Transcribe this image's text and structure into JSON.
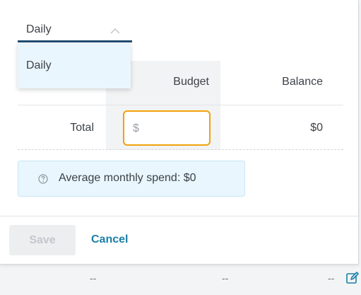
{
  "period_select": {
    "value": "Daily",
    "options": [
      "Daily"
    ],
    "accent_color": "#234d73"
  },
  "table": {
    "headers": {
      "budget": "Budget",
      "balance": "Balance"
    },
    "rows": [
      {
        "label": "Total",
        "budget_placeholder": "$",
        "budget_value": "",
        "balance": "$0"
      }
    ]
  },
  "info": {
    "icon": "question-circle-icon",
    "text": "Average monthly spend: $0"
  },
  "footer": {
    "save_label": "Save",
    "cancel_label": "Cancel",
    "cancel_color": "#1a7fa6"
  },
  "underlying_row": {
    "cells": [
      "--",
      "--",
      "--"
    ],
    "edit_icon": "edit-icon"
  },
  "colors": {
    "input_focus_border": "#f2a20c",
    "info_background": "#e9f6fd"
  }
}
